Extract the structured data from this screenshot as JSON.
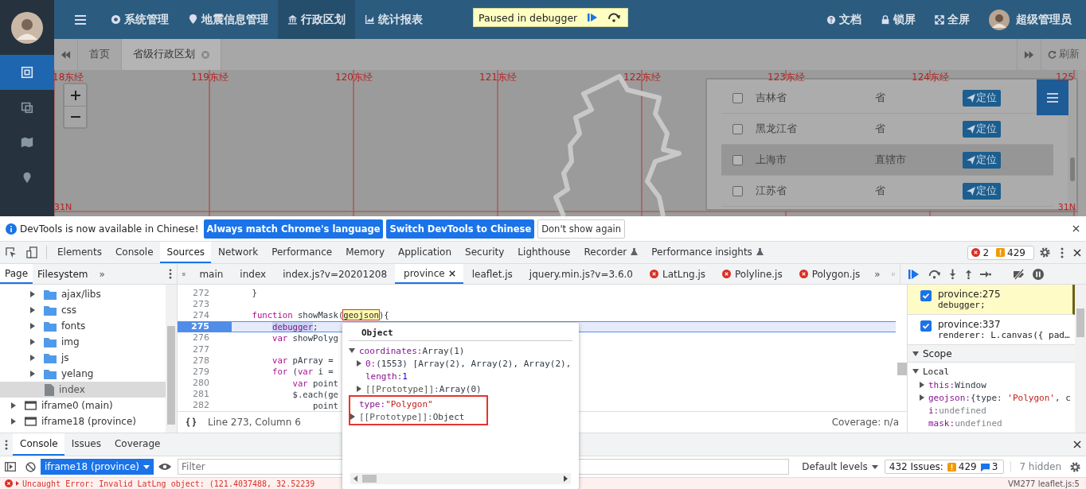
{
  "app": {
    "sidebar": {
      "items": [
        {
          "selected": true
        },
        {
          "selected": false
        },
        {
          "selected": false
        },
        {
          "selected": false
        }
      ]
    },
    "nav": [
      {
        "label": "系统管理",
        "selected": false
      },
      {
        "label": "地震信息管理",
        "selected": false
      },
      {
        "label": "行政区划",
        "selected": true
      },
      {
        "label": "统计报表",
        "selected": false
      }
    ],
    "nav_right": [
      "文档",
      "锁屏",
      "全屏"
    ],
    "user": "超级管理员",
    "debugger_badge": "Paused in debugger",
    "tabs": [
      {
        "label": "首页",
        "selected": false,
        "closable": false
      },
      {
        "label": "省级行政区划",
        "selected": true,
        "closable": true
      }
    ],
    "refresh": "刷新",
    "map": {
      "lon_labels": [
        "18东经",
        "119东经",
        "120东经",
        "121东经",
        "122东经",
        "123东经",
        "124东经",
        "125"
      ],
      "lat_labels": [
        "31N",
        "31N"
      ],
      "rows": [
        {
          "name": "吉林省",
          "type": "省",
          "button": "定位",
          "checked": false,
          "selected": false
        },
        {
          "name": "黑龙江省",
          "type": "省",
          "button": "定位",
          "checked": false,
          "selected": false
        },
        {
          "name": "上海市",
          "type": "直辖市",
          "button": "定位",
          "checked": false,
          "selected": true
        },
        {
          "name": "江苏省",
          "type": "省",
          "button": "定位",
          "checked": false,
          "selected": false
        }
      ]
    }
  },
  "devtools": {
    "banner": {
      "text": "DevTools is now available in Chinese!",
      "buttons": [
        "Always match Chrome's language",
        "Switch DevTools to Chinese"
      ],
      "dismiss": "Don't show again"
    },
    "tabs": [
      {
        "label": "Elements",
        "selected": false,
        "experimental": false
      },
      {
        "label": "Console",
        "selected": false,
        "experimental": false
      },
      {
        "label": "Sources",
        "selected": true,
        "experimental": false
      },
      {
        "label": "Network",
        "selected": false,
        "experimental": false
      },
      {
        "label": "Performance",
        "selected": false,
        "experimental": false
      },
      {
        "label": "Memory",
        "selected": false,
        "experimental": false
      },
      {
        "label": "Application",
        "selected": false,
        "experimental": false
      },
      {
        "label": "Security",
        "selected": false,
        "experimental": false
      },
      {
        "label": "Lighthouse",
        "selected": false,
        "experimental": false
      },
      {
        "label": "Recorder",
        "selected": false,
        "experimental": true
      },
      {
        "label": "Performance insights",
        "selected": false,
        "experimental": true
      }
    ],
    "error_count": "2",
    "warning_count": "429",
    "navigator_tabs": [
      {
        "label": "Page",
        "selected": true
      },
      {
        "label": "Filesystem",
        "selected": false
      }
    ],
    "more": "»",
    "tree": [
      {
        "label": "ajax/libs",
        "kind": "folder",
        "selected": false
      },
      {
        "label": "css",
        "kind": "folder",
        "selected": false
      },
      {
        "label": "fonts",
        "kind": "folder",
        "selected": false
      },
      {
        "label": "img",
        "kind": "folder",
        "selected": false
      },
      {
        "label": "js",
        "kind": "folder",
        "selected": false
      },
      {
        "label": "yelang",
        "kind": "folder",
        "selected": false
      },
      {
        "label": "index",
        "kind": "file",
        "selected": true
      },
      {
        "label": "iframe0 (main)",
        "kind": "frame",
        "selected": false
      },
      {
        "label": "iframe18 (province)",
        "kind": "frame",
        "selected": false
      }
    ],
    "file_tabs": [
      {
        "label": "main",
        "selected": false,
        "error": false
      },
      {
        "label": "index",
        "selected": false,
        "error": false
      },
      {
        "label": "index.js?v=20201208",
        "selected": false,
        "error": false
      },
      {
        "label": "province",
        "selected": true,
        "error": false
      },
      {
        "label": "leaflet.js",
        "selected": false,
        "error": false
      },
      {
        "label": "jquery.min.js?v=3.6.0",
        "selected": false,
        "error": false
      },
      {
        "label": "LatLng.js",
        "selected": false,
        "error": true
      },
      {
        "label": "Polyline.js",
        "selected": false,
        "error": true
      },
      {
        "label": "Polygon.js",
        "selected": false,
        "error": true
      }
    ],
    "file_tabs_more": "»",
    "code": [
      {
        "number": "272",
        "current": false,
        "tokens": [
          {
            "text": "    }",
            "kind": "plain"
          }
        ]
      },
      {
        "number": "273",
        "current": false
      },
      {
        "number": "274",
        "current": false,
        "tokens": [
          {
            "text": "    function",
            "kind": "keyword"
          },
          {
            "text": " showMask(",
            "kind": "plain"
          },
          {
            "text": "geojson",
            "kind": "match"
          },
          {
            "text": "){",
            "kind": "plain"
          }
        ]
      },
      {
        "number": "275",
        "current": true,
        "tokens": [
          {
            "text": "        debugger",
            "kind": "paused"
          },
          {
            "text": ";",
            "kind": "plain"
          }
        ]
      },
      {
        "number": "276",
        "current": false,
        "tokens": [
          {
            "text": "        var",
            "kind": "keyword"
          },
          {
            "text": " showPolyg",
            "kind": "plain"
          }
        ]
      },
      {
        "number": "277",
        "current": false
      },
      {
        "number": "278",
        "current": false,
        "tokens": [
          {
            "text": "        var",
            "kind": "keyword"
          },
          {
            "text": " pArray =",
            "kind": "plain"
          }
        ]
      },
      {
        "number": "279",
        "current": false,
        "tokens": [
          {
            "text": "        for",
            "kind": "keyword"
          },
          {
            "text": " (",
            "kind": "plain"
          },
          {
            "text": "var",
            "kind": "keyword"
          },
          {
            "text": " i =",
            "kind": "plain"
          }
        ]
      },
      {
        "number": "280",
        "current": false,
        "tokens": [
          {
            "text": "            var",
            "kind": "keyword"
          },
          {
            "text": " point",
            "kind": "plain"
          }
        ]
      },
      {
        "number": "281",
        "current": false,
        "tokens": [
          {
            "text": "            $.each(ge",
            "kind": "plain"
          }
        ]
      },
      {
        "number": "282",
        "current": false,
        "tokens": [
          {
            "text": "                point",
            "kind": "plain"
          }
        ]
      }
    ],
    "status": "Line 273, Column 6",
    "coverage": "Coverage: n/a",
    "breakpoints": [
      {
        "location": "province:275",
        "code": "debugger;",
        "checked": true,
        "selected": true
      },
      {
        "location": "province:337",
        "code": "renderer: L.canvas({ pad…",
        "checked": true,
        "selected": false
      }
    ],
    "scope_title": "Scope",
    "scope_group": "Local",
    "scope": [
      {
        "name": "this:",
        "expanded": false,
        "value": [
          {
            "text": "Window",
            "kind": "plain"
          }
        ]
      },
      {
        "name": "geojson:",
        "expanded": false,
        "value": [
          {
            "text": "{type: ",
            "kind": "plain"
          },
          {
            "text": "'Polygon'",
            "kind": "string"
          },
          {
            "text": ", c",
            "kind": "plain"
          }
        ]
      },
      {
        "name": "i:",
        "value": [
          {
            "text": "undefined",
            "kind": "dim"
          }
        ]
      },
      {
        "name": "mask:",
        "value": [
          {
            "text": "undefined",
            "kind": "dim"
          }
        ]
      }
    ],
    "popover": {
      "title": "Object",
      "properties": [
        {
          "name": "coordinates:",
          "value": "Array(1)",
          "kind": "plain",
          "expanded": true,
          "internal": false,
          "children": [
            {
              "name": "0:",
              "value": "(1553) [Array(2), Array(2), Array(2),",
              "kind": "plain",
              "expanded": false,
              "internal": false
            },
            {
              "name": "length:",
              "value": "1",
              "kind": "number",
              "internal": false
            },
            {
              "name": "[[Prototype]]:",
              "value": "Array(0)",
              "kind": "plain",
              "expanded": false,
              "internal": true
            }
          ]
        }
      ],
      "outlined": [
        {
          "name": "type:",
          "value": "\"Polygon\"",
          "kind": "string",
          "internal": false
        },
        {
          "name": "[[Prototype]]:",
          "value": "Object",
          "kind": "plain",
          "expanded": false,
          "internal": true
        }
      ]
    },
    "drawer_tabs": [
      {
        "label": "Console",
        "selected": true
      },
      {
        "label": "Issues",
        "selected": false
      },
      {
        "label": "Coverage",
        "selected": false
      }
    ],
    "context": "iframe18 (province)",
    "filter": {
      "placeholder": "Filter"
    },
    "levels": "Default levels",
    "issues": {
      "label": "432 Issues:",
      "warnings": "429",
      "info": "3"
    },
    "hidden": "7 hidden",
    "error_line": {
      "text": "Uncaught Error: Invalid LatLng object: (121.4037488, 32.52239",
      "source": "VM277 leaflet.js:5"
    }
  }
}
